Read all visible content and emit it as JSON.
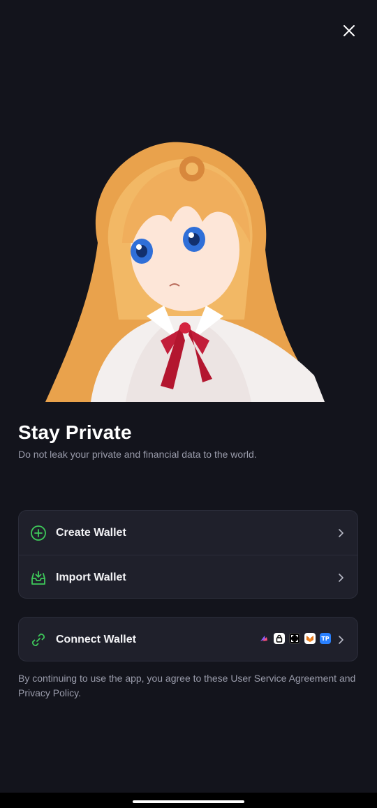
{
  "hero": {
    "title": "Stay Private",
    "subtitle": "Do not leak your private and financial data to the world."
  },
  "actions": {
    "create_label": "Create Wallet",
    "import_label": "Import Wallet",
    "connect_label": "Connect Wallet"
  },
  "providers": [
    {
      "name": "rabby-icon",
      "label": ""
    },
    {
      "name": "lock-wallet-icon",
      "label": ""
    },
    {
      "name": "scan-wallet-icon",
      "label": ""
    },
    {
      "name": "metamask-icon",
      "label": ""
    },
    {
      "name": "tokenpocket-icon",
      "label": "TP"
    }
  ],
  "legal": {
    "text": "By continuing to use the app, you agree to these User Service Agreement and Privacy Policy."
  },
  "colors": {
    "background": "#13141c",
    "card": "#1f202b",
    "accent_green": "#3ec95a"
  }
}
